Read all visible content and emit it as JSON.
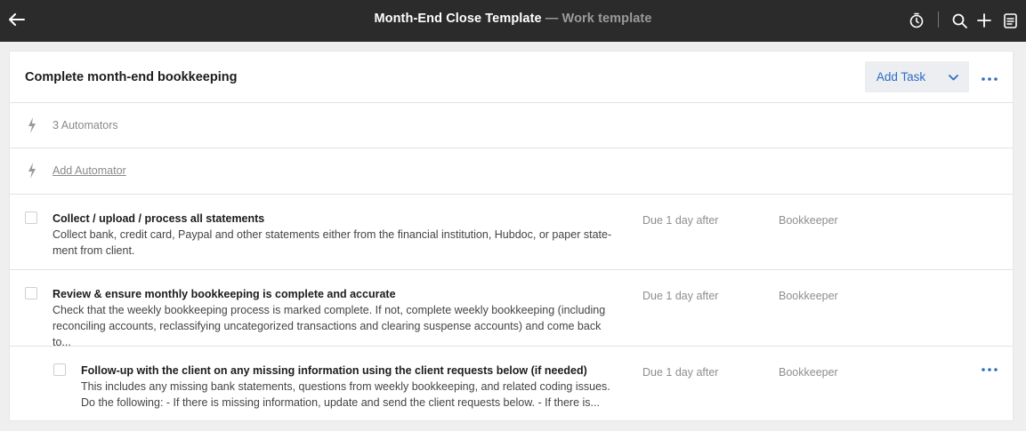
{
  "topbar": {
    "title": "Month-End Close Template",
    "subtitle": "— Work template",
    "icons": [
      "back-arrow-icon",
      "timer-icon",
      "search-icon",
      "plus-icon",
      "notes-icon"
    ]
  },
  "checklist": {
    "heading": "Complete month-end bookkeeping",
    "add_task_label": "Add Task"
  },
  "automators": {
    "count_label": "3 Automators",
    "add_label": "Add Automator"
  },
  "tasks": [
    {
      "title": "Collect / upload / process all statements",
      "desc_line1": "Collect bank, credit card, Paypal and other statements either from the financial institution, Hubdoc, or paper state-",
      "desc_line2": "ment from client.",
      "due": "Due 1 day after",
      "role": "Bookkeeper"
    },
    {
      "title": "Review & ensure monthly bookkeeping is complete and accurate",
      "desc_line1": "Check that the weekly bookkeeping process is marked complete. If not, complete weekly bookkeeping (including",
      "desc_line2": "reconciling accounts, reclassifying uncategorized transactions and clearing suspense accounts) and come back to...",
      "due": "Due 1 day after",
      "role": "Bookkeeper"
    },
    {
      "title": "Follow-up with the client on any missing information using the client requests below (if needed)",
      "desc_line1": "This includes any missing bank statements, questions from weekly bookkeeping, and related coding issues.",
      "desc_line2": "Do the following: - If there is missing information, update and send the client requests below. - If there is...",
      "due": "Due 1 day after",
      "role": "Bookkeeper"
    }
  ],
  "colors": {
    "topbar_bg": "#2b2b2b",
    "accent": "#2e6dc2",
    "muted_text": "#8e8e8e"
  }
}
